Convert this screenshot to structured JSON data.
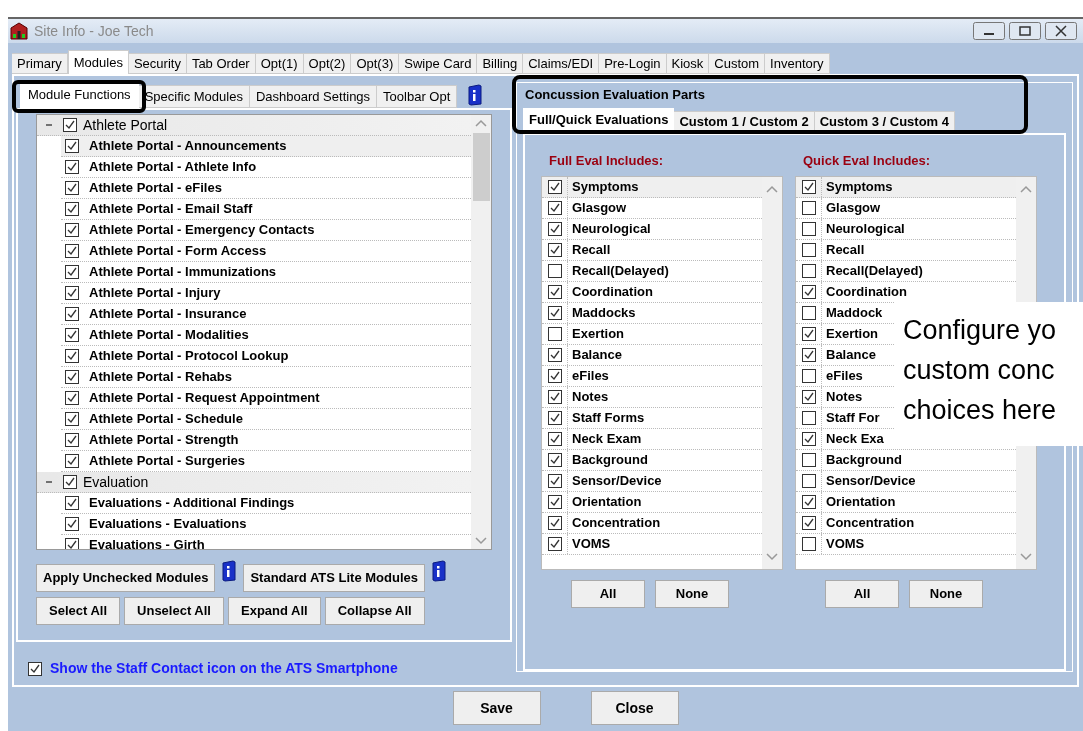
{
  "window": {
    "title": "Site Info - Joe Tech"
  },
  "tabs": [
    {
      "label": "Primary",
      "selected": false
    },
    {
      "label": "Modules",
      "selected": true
    },
    {
      "label": "Security",
      "selected": false
    },
    {
      "label": "Tab Order",
      "selected": false
    },
    {
      "label": "Opt(1)",
      "selected": false
    },
    {
      "label": "Opt(2)",
      "selected": false
    },
    {
      "label": "Opt(3)",
      "selected": false
    },
    {
      "label": "Swipe Card",
      "selected": false
    },
    {
      "label": "Billing",
      "selected": false
    },
    {
      "label": "Claims/EDI",
      "selected": false
    },
    {
      "label": "Pre-Login",
      "selected": false
    },
    {
      "label": "Kiosk",
      "selected": false
    },
    {
      "label": "Custom",
      "selected": false
    },
    {
      "label": "Inventory",
      "selected": false
    }
  ],
  "module_tabs": [
    {
      "label": "Module Functions",
      "selected": true
    },
    {
      "label": "Specific Modules",
      "selected": false
    },
    {
      "label": "Dashboard Settings",
      "selected": false
    },
    {
      "label": "Toolbar Opt",
      "selected": false
    }
  ],
  "module_tree": [
    {
      "label": "Athlete Portal",
      "checked": true,
      "expanded": true,
      "children": [
        {
          "label": "Athlete Portal - Announcements",
          "checked": true,
          "selected": true
        },
        {
          "label": "Athlete Portal - Athlete Info",
          "checked": true,
          "selected": false
        },
        {
          "label": "Athlete Portal - eFiles",
          "checked": true,
          "selected": false
        },
        {
          "label": "Athlete Portal - Email Staff",
          "checked": true,
          "selected": false
        },
        {
          "label": "Athlete Portal - Emergency Contacts",
          "checked": true,
          "selected": false
        },
        {
          "label": "Athlete Portal - Form Access",
          "checked": true,
          "selected": false
        },
        {
          "label": "Athlete Portal - Immunizations",
          "checked": true,
          "selected": false
        },
        {
          "label": "Athlete Portal - Injury",
          "checked": true,
          "selected": false
        },
        {
          "label": "Athlete Portal - Insurance",
          "checked": true,
          "selected": false
        },
        {
          "label": "Athlete Portal - Modalities",
          "checked": true,
          "selected": false
        },
        {
          "label": "Athlete Portal - Protocol Lookup",
          "checked": true,
          "selected": false
        },
        {
          "label": "Athlete Portal - Rehabs",
          "checked": true,
          "selected": false
        },
        {
          "label": "Athlete Portal - Request Appointment",
          "checked": true,
          "selected": false
        },
        {
          "label": "Athlete Portal - Schedule",
          "checked": true,
          "selected": false
        },
        {
          "label": "Athlete Portal - Strength",
          "checked": true,
          "selected": false
        },
        {
          "label": "Athlete Portal - Surgeries",
          "checked": true,
          "selected": false
        }
      ]
    },
    {
      "label": "Evaluation",
      "checked": true,
      "expanded": true,
      "children": [
        {
          "label": "Evaluations - Additional Findings",
          "checked": true,
          "selected": false
        },
        {
          "label": "Evaluations - Evaluations",
          "checked": true,
          "selected": false
        },
        {
          "label": "Evaluations - Girth",
          "checked": true,
          "selected": false
        }
      ]
    }
  ],
  "module_buttons": [
    "Apply Unchecked Modules",
    "Standard ATS Lite Modules"
  ],
  "tree_buttons": [
    "Select All",
    "Unselect All",
    "Expand All",
    "Collapse All"
  ],
  "smartphone_option": {
    "label": "Show the Staff Contact icon on the ATS Smartphone",
    "checked": true
  },
  "concussion": {
    "title": "Concussion Evaluation Parts",
    "tabs": [
      {
        "label": "Full/Quick Evaluations",
        "selected": true
      },
      {
        "label": "Custom 1 / Custom 2",
        "selected": false
      },
      {
        "label": "Custom 3 / Custom 4",
        "selected": false
      }
    ],
    "lists": [
      {
        "heading": "Full Eval Includes:",
        "buttons": [
          "All",
          "None"
        ],
        "items": [
          {
            "label": "Symptoms",
            "checked": true
          },
          {
            "label": "Glasgow",
            "checked": true
          },
          {
            "label": "Neurological",
            "checked": true
          },
          {
            "label": "Recall",
            "checked": true
          },
          {
            "label": "Recall(Delayed)",
            "checked": false
          },
          {
            "label": "Coordination",
            "checked": true
          },
          {
            "label": "Maddocks",
            "checked": true
          },
          {
            "label": "Exertion",
            "checked": false
          },
          {
            "label": "Balance",
            "checked": true
          },
          {
            "label": "eFiles",
            "checked": true
          },
          {
            "label": "Notes",
            "checked": true
          },
          {
            "label": "Staff Forms",
            "checked": true
          },
          {
            "label": "Neck Exam",
            "checked": true
          },
          {
            "label": "Background",
            "checked": true
          },
          {
            "label": "Sensor/Device",
            "checked": true
          },
          {
            "label": "Orientation",
            "checked": true
          },
          {
            "label": "Concentration",
            "checked": true
          },
          {
            "label": "VOMS",
            "checked": true
          }
        ]
      },
      {
        "heading": "Quick Eval Includes:",
        "buttons": [
          "All",
          "None"
        ],
        "items": [
          {
            "label": "Symptoms",
            "checked": true
          },
          {
            "label": "Glasgow",
            "checked": false
          },
          {
            "label": "Neurological",
            "checked": false
          },
          {
            "label": "Recall",
            "checked": false
          },
          {
            "label": "Recall(Delayed)",
            "checked": false
          },
          {
            "label": "Coordination",
            "checked": true
          },
          {
            "label": "Maddock",
            "checked": false
          },
          {
            "label": "Exertion",
            "checked": true
          },
          {
            "label": "Balance",
            "checked": true
          },
          {
            "label": "eFiles",
            "checked": false
          },
          {
            "label": "Notes",
            "checked": true
          },
          {
            "label": "Staff For",
            "checked": false
          },
          {
            "label": "Neck Exa",
            "checked": true
          },
          {
            "label": "Background",
            "checked": false
          },
          {
            "label": "Sensor/Device",
            "checked": false
          },
          {
            "label": "Orientation",
            "checked": true
          },
          {
            "label": "Concentration",
            "checked": true
          },
          {
            "label": "VOMS",
            "checked": false
          }
        ]
      }
    ]
  },
  "callout": {
    "lines": [
      "Configure yo",
      "custom conc",
      "choices here"
    ]
  },
  "buttons": [
    "Save",
    "Close"
  ]
}
